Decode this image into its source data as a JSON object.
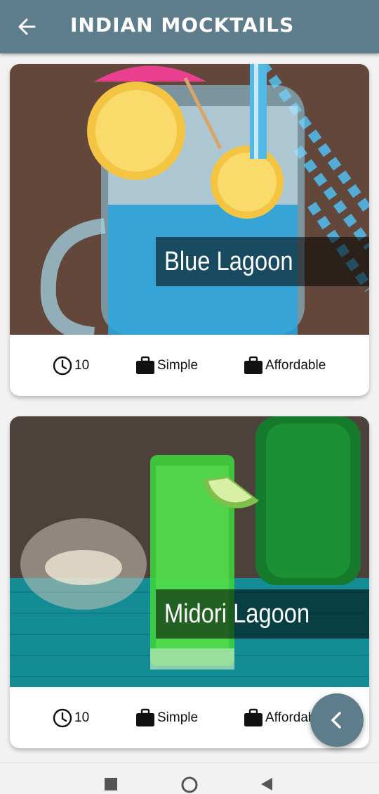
{
  "appbar": {
    "title": "INDIAN MOCKTAILS",
    "back_icon": "arrow-left-icon"
  },
  "meals": [
    {
      "title": "Blue Lagoon",
      "duration": "10",
      "complexity": "Simple",
      "affordability": "Affordable",
      "image_description_icon": "blue-lagoon-photo"
    },
    {
      "title": "Midori Lagoon",
      "duration": "10",
      "complexity": "Simple",
      "affordability": "Affordable",
      "image_description_icon": "midori-lagoon-photo"
    }
  ],
  "fab": {
    "icon": "chevron-left-icon"
  },
  "navbar": {
    "icons": [
      "square-icon",
      "circle-icon",
      "triangle-back-icon"
    ]
  },
  "colors": {
    "appbar": "#5e7d8c",
    "background": "#f2f2f2",
    "card": "#ffffff"
  }
}
